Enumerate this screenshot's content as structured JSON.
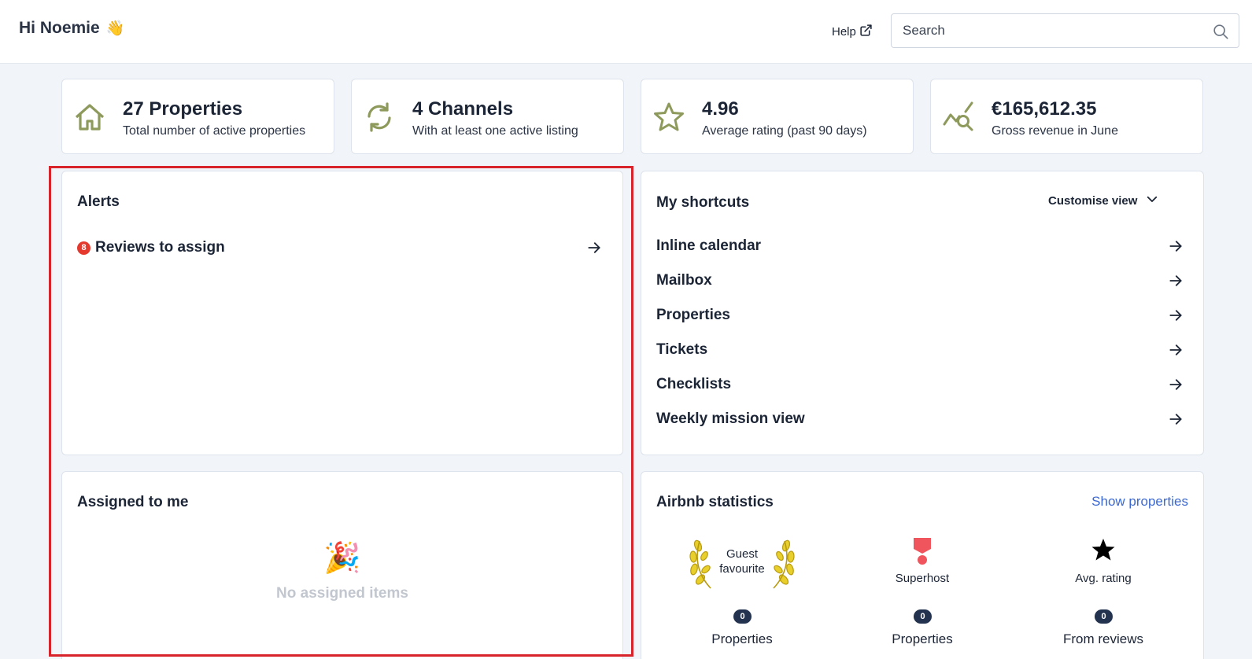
{
  "header": {
    "greeting": "Hi Noemie",
    "greeting_emoji": "👋",
    "help_label": "Help",
    "search_placeholder": "Search"
  },
  "stats": [
    {
      "value": "27 Properties",
      "label": "Total number of active properties",
      "icon": "house-icon"
    },
    {
      "value": "4 Channels",
      "label": "With at least one active listing",
      "icon": "sync-icon"
    },
    {
      "value": "4.96",
      "label": "Average rating (past 90 days)",
      "icon": "star-outline-icon"
    },
    {
      "value": "€165,612.35",
      "label": "Gross revenue in June",
      "icon": "chart-search-icon"
    }
  ],
  "alerts": {
    "title": "Alerts",
    "items": [
      {
        "count": "8",
        "label": "Reviews to assign"
      }
    ]
  },
  "assigned": {
    "title": "Assigned to me",
    "empty_emoji": "🎉",
    "empty_text": "No assigned items"
  },
  "shortcuts": {
    "title": "My shortcuts",
    "customise_label": "Customise view",
    "items": [
      {
        "label": "Inline calendar"
      },
      {
        "label": "Mailbox"
      },
      {
        "label": "Properties"
      },
      {
        "label": "Tickets"
      },
      {
        "label": "Checklists"
      },
      {
        "label": "Weekly mission view"
      }
    ]
  },
  "airbnb": {
    "title": "Airbnb statistics",
    "show_properties_label": "Show properties",
    "columns": [
      {
        "label_line1": "Guest",
        "label_line2": "favourite",
        "count": "0",
        "sub": "Properties",
        "icon": "laurel-icon"
      },
      {
        "label": "Superhost",
        "count": "0",
        "sub": "Properties",
        "icon": "superhost-icon"
      },
      {
        "label": "Avg. rating",
        "count": "0",
        "sub": "From reviews",
        "icon": "star-filled-icon"
      }
    ]
  },
  "colors": {
    "accent_olive": "#8d9a5c",
    "alert_red": "#e5392d",
    "link_blue": "#3a67d1",
    "highlight_red": "#d8232a",
    "badge_navy": "#23324f"
  }
}
